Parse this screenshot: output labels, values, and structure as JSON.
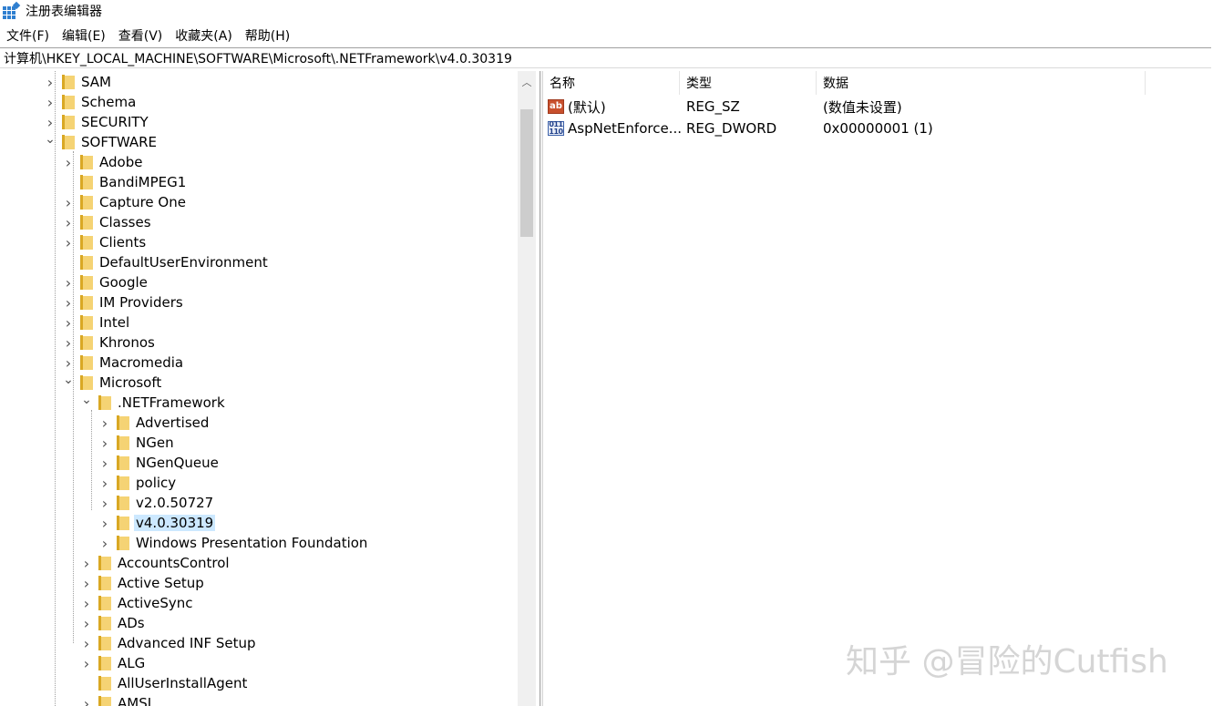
{
  "window": {
    "title": "注册表编辑器",
    "icon": "regedit-icon"
  },
  "menu": [
    {
      "label": "文件(F)"
    },
    {
      "label": "编辑(E)"
    },
    {
      "label": "查看(V)"
    },
    {
      "label": "收藏夹(A)"
    },
    {
      "label": "帮助(H)"
    }
  ],
  "address": {
    "path": "计算机\\HKEY_LOCAL_MACHINE\\SOFTWARE\\Microsoft\\.NETFramework\\v4.0.30319"
  },
  "tree": {
    "nodes": [
      {
        "label": "SAM",
        "expander": "collapsed"
      },
      {
        "label": "Schema",
        "expander": "collapsed"
      },
      {
        "label": "SECURITY",
        "expander": "collapsed"
      },
      {
        "label": "SOFTWARE",
        "expander": "expanded"
      },
      {
        "label": "Adobe",
        "expander": "collapsed"
      },
      {
        "label": "BandiMPEG1",
        "expander": "none"
      },
      {
        "label": "Capture One",
        "expander": "collapsed"
      },
      {
        "label": "Classes",
        "expander": "collapsed"
      },
      {
        "label": "Clients",
        "expander": "collapsed"
      },
      {
        "label": "DefaultUserEnvironment",
        "expander": "none"
      },
      {
        "label": "Google",
        "expander": "collapsed"
      },
      {
        "label": "IM Providers",
        "expander": "collapsed"
      },
      {
        "label": "Intel",
        "expander": "collapsed"
      },
      {
        "label": "Khronos",
        "expander": "collapsed"
      },
      {
        "label": "Macromedia",
        "expander": "collapsed"
      },
      {
        "label": "Microsoft",
        "expander": "expanded"
      },
      {
        "label": ".NETFramework",
        "expander": "expanded"
      },
      {
        "label": "Advertised",
        "expander": "collapsed"
      },
      {
        "label": "NGen",
        "expander": "collapsed"
      },
      {
        "label": "NGenQueue",
        "expander": "collapsed"
      },
      {
        "label": "policy",
        "expander": "collapsed"
      },
      {
        "label": "v2.0.50727",
        "expander": "collapsed"
      },
      {
        "label": "v4.0.30319",
        "expander": "collapsed",
        "selected": true
      },
      {
        "label": "Windows Presentation Foundation",
        "expander": "collapsed"
      },
      {
        "label": "AccountsControl",
        "expander": "collapsed"
      },
      {
        "label": "Active Setup",
        "expander": "collapsed"
      },
      {
        "label": "ActiveSync",
        "expander": "collapsed"
      },
      {
        "label": "ADs",
        "expander": "collapsed"
      },
      {
        "label": "Advanced INF Setup",
        "expander": "collapsed"
      },
      {
        "label": "ALG",
        "expander": "collapsed"
      },
      {
        "label": "AllUserInstallAgent",
        "expander": "none"
      },
      {
        "label": "AMSI",
        "expander": "collapsed"
      }
    ]
  },
  "values": {
    "columns": [
      {
        "label": "名称"
      },
      {
        "label": "类型"
      },
      {
        "label": "数据"
      }
    ],
    "rows": [
      {
        "icon": "string-value-icon",
        "name": "(默认)",
        "type": "REG_SZ",
        "data": "(数值未设置)"
      },
      {
        "icon": "binary-value-icon",
        "name": "AspNetEnforce...",
        "type": "REG_DWORD",
        "data": "0x00000001 (1)"
      }
    ]
  },
  "watermark": {
    "text": "知乎 @冒险的Cutfish"
  }
}
